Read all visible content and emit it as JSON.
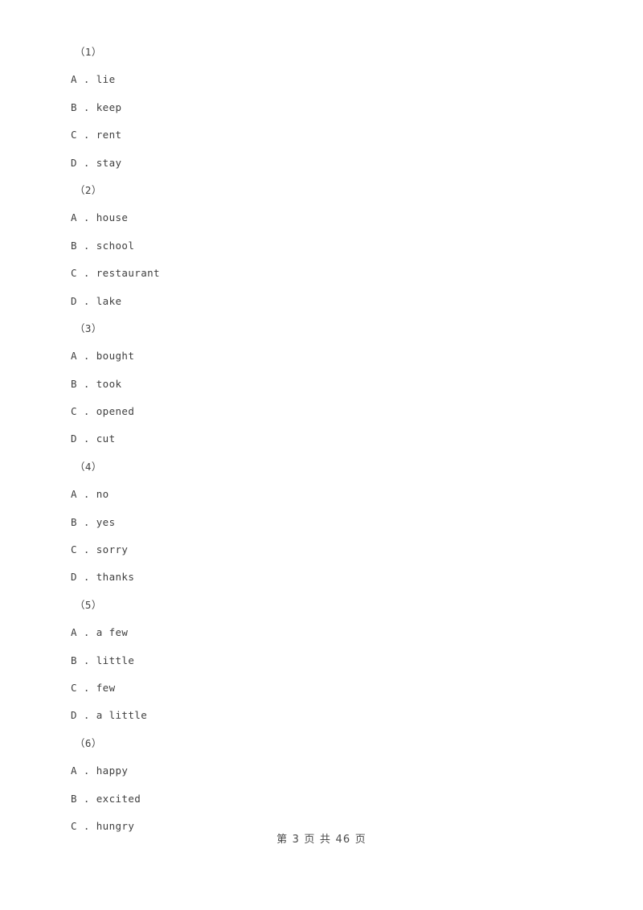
{
  "page": {
    "background_color": "#ffffff",
    "text_color": "#3f3f3f"
  },
  "questions": [
    {
      "number": "（1）",
      "options": [
        {
          "letter": "A",
          "separator": " . ",
          "text": "lie"
        },
        {
          "letter": "B",
          "separator": " . ",
          "text": "keep"
        },
        {
          "letter": "C",
          "separator": " . ",
          "text": "rent"
        },
        {
          "letter": "D",
          "separator": " . ",
          "text": "stay"
        }
      ]
    },
    {
      "number": "（2）",
      "options": [
        {
          "letter": "A",
          "separator": " . ",
          "text": "house"
        },
        {
          "letter": "B",
          "separator": " . ",
          "text": "school"
        },
        {
          "letter": "C",
          "separator": " . ",
          "text": "restaurant"
        },
        {
          "letter": "D",
          "separator": " . ",
          "text": "lake"
        }
      ]
    },
    {
      "number": "（3）",
      "options": [
        {
          "letter": "A",
          "separator": " . ",
          "text": "bought"
        },
        {
          "letter": "B",
          "separator": " . ",
          "text": "took"
        },
        {
          "letter": "C",
          "separator": " . ",
          "text": "opened"
        },
        {
          "letter": "D",
          "separator": " . ",
          "text": "cut"
        }
      ]
    },
    {
      "number": "（4）",
      "options": [
        {
          "letter": "A",
          "separator": " . ",
          "text": "no"
        },
        {
          "letter": "B",
          "separator": " . ",
          "text": "yes"
        },
        {
          "letter": "C",
          "separator": " . ",
          "text": "sorry"
        },
        {
          "letter": "D",
          "separator": " . ",
          "text": "thanks"
        }
      ]
    },
    {
      "number": "（5）",
      "options": [
        {
          "letter": "A",
          "separator": " . ",
          "text": "a few"
        },
        {
          "letter": "B",
          "separator": " . ",
          "text": "little"
        },
        {
          "letter": "C",
          "separator": " . ",
          "text": "few"
        },
        {
          "letter": "D",
          "separator": " . ",
          "text": "a little"
        }
      ]
    },
    {
      "number": "（6）",
      "options": [
        {
          "letter": "A",
          "separator": " . ",
          "text": "happy"
        },
        {
          "letter": "B",
          "separator": " . ",
          "text": "excited"
        },
        {
          "letter": "C",
          "separator": " . ",
          "text": "hungry"
        }
      ]
    }
  ],
  "footer": {
    "text": "第 3 页 共 46 页",
    "current_page": "3",
    "total_pages": "46"
  }
}
